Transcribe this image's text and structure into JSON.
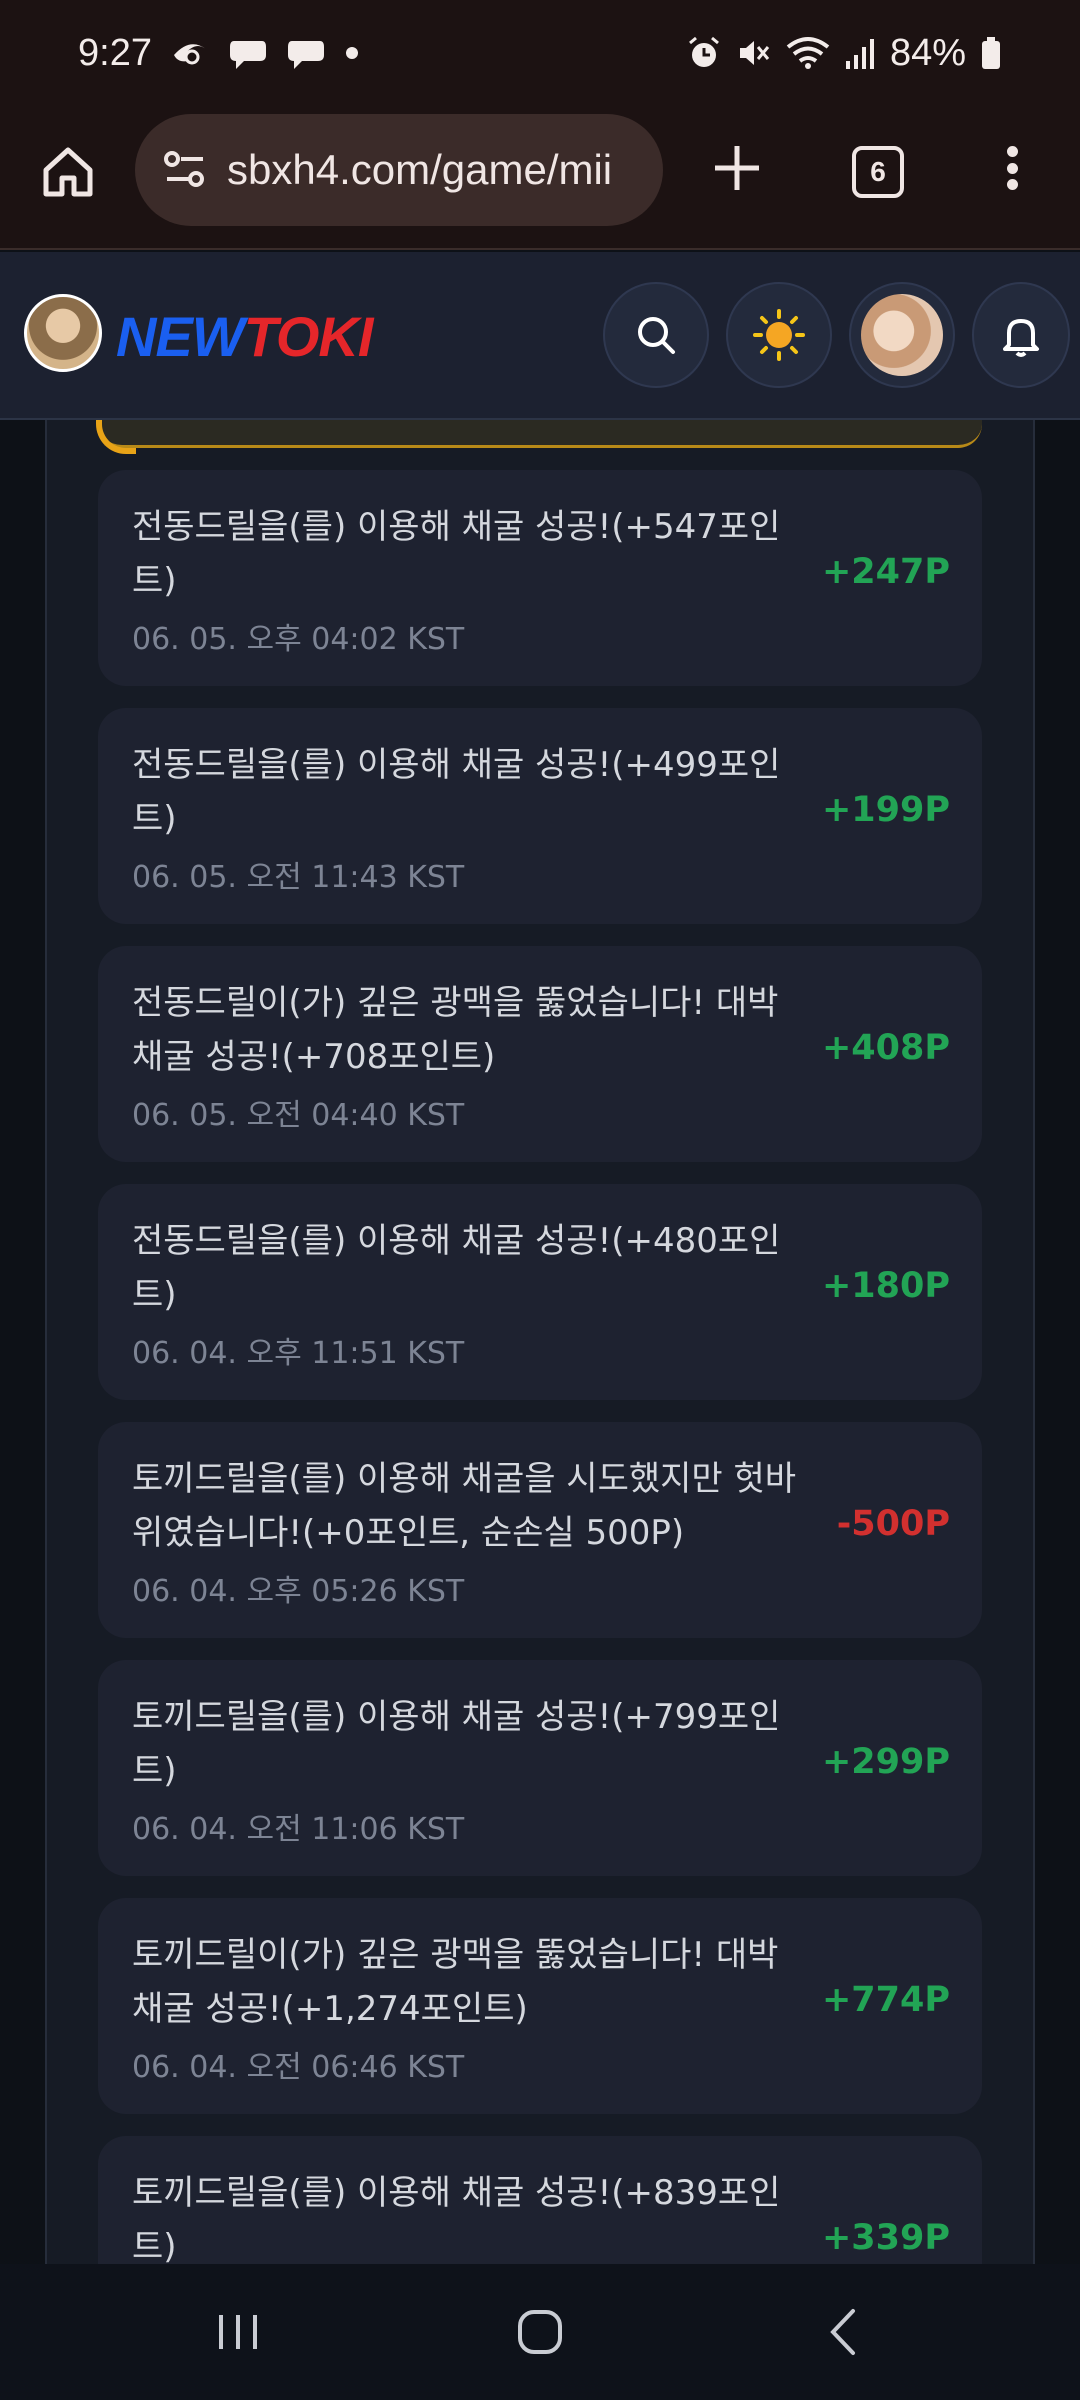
{
  "status_bar": {
    "time": "9:27",
    "battery": "84%",
    "icons": [
      "notification-icon",
      "chat-icon",
      "chat-icon",
      "dot-icon",
      "alarm-icon",
      "mute-icon",
      "wifi-icon",
      "signal-icon",
      "battery-icon"
    ]
  },
  "browser": {
    "url": "sbxh4.com/game/mii",
    "tab_count": "6"
  },
  "site": {
    "logo_new": "NEW",
    "logo_toki": "TOKI"
  },
  "history": [
    {
      "desc": "전동드릴을(를) 이용해 채굴 성공!(+547포인트)",
      "time": "06. 05. 오후 04:02 KST",
      "amount": "+247P",
      "type": "positive"
    },
    {
      "desc": "전동드릴을(를) 이용해 채굴 성공!(+499포인트)",
      "time": "06. 05. 오전 11:43 KST",
      "amount": "+199P",
      "type": "positive"
    },
    {
      "desc": "전동드릴이(가) 깊은 광맥을 뚫었습니다! 대박 채굴 성공!(+708포인트)",
      "time": "06. 05. 오전 04:40 KST",
      "amount": "+408P",
      "type": "positive"
    },
    {
      "desc": "전동드릴을(를) 이용해 채굴 성공!(+480포인트)",
      "time": "06. 04. 오후 11:51 KST",
      "amount": "+180P",
      "type": "positive"
    },
    {
      "desc": "토끼드릴을(를) 이용해 채굴을 시도했지만 헛바위였습니다!(+0포인트, 순손실 500P)",
      "time": "06. 04. 오후 05:26 KST",
      "amount": "-500P",
      "type": "negative"
    },
    {
      "desc": "토끼드릴을(를) 이용해 채굴 성공!(+799포인트)",
      "time": "06. 04. 오전 11:06 KST",
      "amount": "+299P",
      "type": "positive"
    },
    {
      "desc": "토끼드릴이(가) 깊은 광맥을 뚫었습니다! 대박 채굴 성공!(+1,274포인트)",
      "time": "06. 04. 오전 06:46 KST",
      "amount": "+774P",
      "type": "positive"
    },
    {
      "desc": "토끼드릴을(를) 이용해 채굴 성공!(+839포인트)",
      "time": "",
      "amount": "+339P",
      "type": "positive"
    }
  ]
}
